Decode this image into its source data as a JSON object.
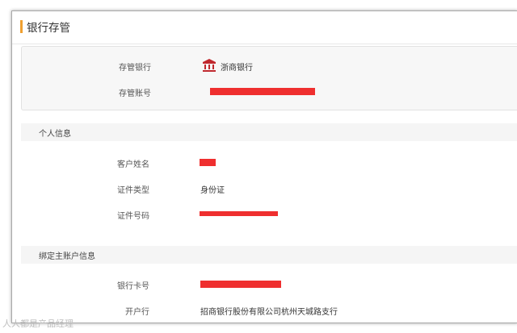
{
  "page": {
    "title": "银行存管"
  },
  "depository": {
    "bank_label": "存管银行",
    "bank_name": "浙商银行",
    "bank_icon": "bank-building-icon",
    "account_label": "存管账号"
  },
  "personal": {
    "section_title": "个人信息",
    "name_label": "客户姓名",
    "id_type_label": "证件类型",
    "id_type_value": "身份证",
    "id_number_label": "证件号码"
  },
  "bound_account": {
    "section_title": "绑定主账户信息",
    "card_label": "银行卡号",
    "branch_label": "开户行",
    "branch_value": "招商银行股份有限公司杭州天城路支行"
  },
  "watermark": {
    "text": "人人都是产品经理"
  },
  "colors": {
    "accent": "#f0a030",
    "redaction": "#ef2f2f",
    "bank_icon": "#c0282e"
  }
}
